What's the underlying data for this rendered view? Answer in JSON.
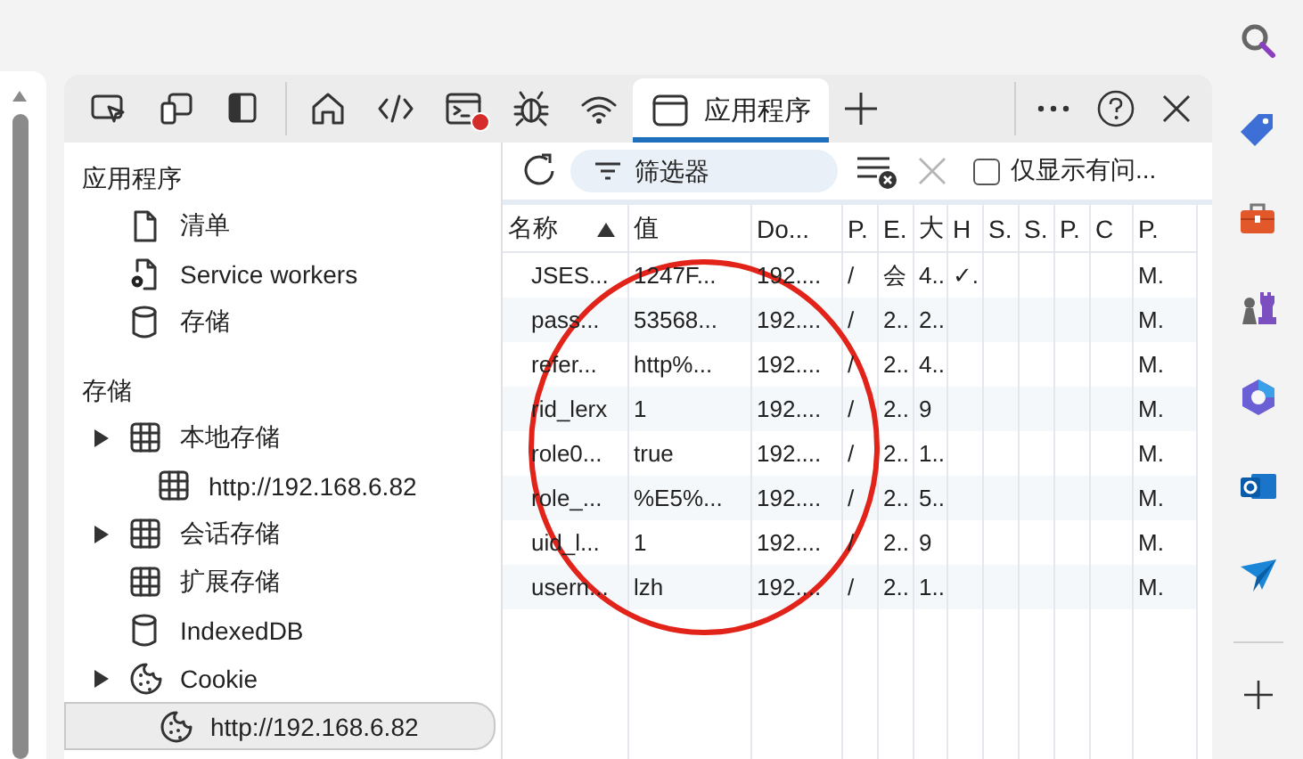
{
  "devtools": {
    "tabs": [
      {
        "selected": false,
        "error_badge": false
      },
      {
        "selected": false,
        "error_badge": false
      },
      {
        "selected": false,
        "error_badge": false
      },
      {
        "selected": false,
        "error_badge": false
      },
      {
        "selected": false,
        "error_badge": false
      },
      {
        "selected": false,
        "error_badge": true
      },
      {
        "selected": false,
        "error_badge": false
      },
      {
        "selected": false,
        "error_badge": false
      },
      {
        "label": "应用程序",
        "selected": true,
        "error_badge": false
      }
    ]
  },
  "sidebar": {
    "sections": [
      {
        "title": "应用程序",
        "items": [
          {
            "label": "清单",
            "kind": "file",
            "selected": false
          },
          {
            "label": "Service workers",
            "kind": "worker",
            "selected": false
          },
          {
            "label": "存储",
            "kind": "store",
            "selected": false
          }
        ]
      },
      {
        "title": "存储",
        "items": [
          {
            "label": "本地存储",
            "kind": "table",
            "selected": false,
            "expanded": false,
            "children": [
              {
                "label": "http://192.168.6.82",
                "kind": "table",
                "selected": false
              }
            ]
          },
          {
            "label": "会话存储",
            "kind": "table",
            "selected": false,
            "expanded": false
          },
          {
            "label": "扩展存储",
            "kind": "table",
            "selected": false
          },
          {
            "label": "IndexedDB",
            "kind": "store",
            "selected": false
          },
          {
            "label": "Cookie",
            "kind": "cookie",
            "selected": false,
            "expanded": false,
            "children": [
              {
                "label": "http://192.168.6.82",
                "kind": "cookie",
                "selected": true
              }
            ]
          }
        ]
      }
    ]
  },
  "toolbar": {
    "filter": {
      "placeholder": "筛选器"
    },
    "delete_disabled": true,
    "only_issues": {
      "label": "仅显示有问...",
      "checked": false
    }
  },
  "table": {
    "columns": [
      {
        "label": "名称",
        "sort_ascending": true
      },
      {
        "label": "值",
        "sort_ascending": false
      },
      {
        "label": "Do...",
        "sort_ascending": false
      },
      {
        "label": "P.",
        "sort_ascending": false
      },
      {
        "label": "E.",
        "sort_ascending": false
      },
      {
        "label": "大",
        "sort_ascending": false
      },
      {
        "label": "H",
        "sort_ascending": false
      },
      {
        "label": "S.",
        "sort_ascending": false
      },
      {
        "label": "S.",
        "sort_ascending": false
      },
      {
        "label": "P.",
        "sort_ascending": false
      },
      {
        "label": "C",
        "sort_ascending": false
      },
      {
        "label": "P.",
        "sort_ascending": false
      }
    ],
    "rows": [
      {
        "cells": [
          "JSES...",
          "1247F...",
          "192....",
          "/",
          "会",
          "4..",
          "✓.",
          "",
          "",
          "",
          "",
          "M."
        ]
      },
      {
        "cells": [
          "pass...",
          "53568...",
          "192....",
          "/",
          "2..",
          "2..",
          "",
          "",
          "",
          "",
          "",
          "M."
        ]
      },
      {
        "cells": [
          "refer...",
          "http%...",
          "192....",
          "/",
          "2..",
          "4..",
          "",
          "",
          "",
          "",
          "",
          "M."
        ]
      },
      {
        "cells": [
          "rid_lerx",
          "1",
          "192....",
          "/",
          "2..",
          "9",
          "",
          "",
          "",
          "",
          "",
          "M."
        ]
      },
      {
        "cells": [
          "role0...",
          "true",
          "192....",
          "/",
          "2..",
          "1..",
          "",
          "",
          "",
          "",
          "",
          "M."
        ]
      },
      {
        "cells": [
          "role_...",
          "%E5%...",
          "192....",
          "/",
          "2..",
          "5..",
          "",
          "",
          "",
          "",
          "",
          "M."
        ]
      },
      {
        "cells": [
          "uid_l...",
          "1",
          "192....",
          "/",
          "2..",
          "9",
          "",
          "",
          "",
          "",
          "",
          "M."
        ]
      },
      {
        "cells": [
          "usern...",
          "lzh",
          "192....",
          "/",
          "2..",
          "1..",
          "",
          "",
          "",
          "",
          "",
          "M."
        ]
      }
    ]
  }
}
